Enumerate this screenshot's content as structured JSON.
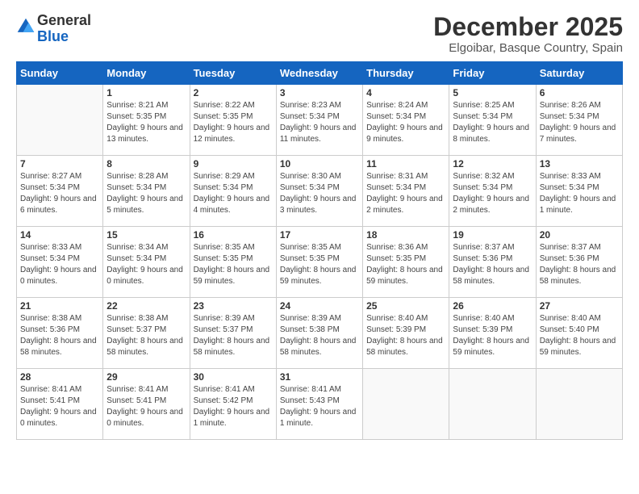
{
  "header": {
    "logo_general": "General",
    "logo_blue": "Blue",
    "month_year": "December 2025",
    "location": "Elgoibar, Basque Country, Spain"
  },
  "weekdays": [
    "Sunday",
    "Monday",
    "Tuesday",
    "Wednesday",
    "Thursday",
    "Friday",
    "Saturday"
  ],
  "weeks": [
    [
      {
        "day": "",
        "sunrise": "",
        "sunset": "",
        "daylight": ""
      },
      {
        "day": "1",
        "sunrise": "Sunrise: 8:21 AM",
        "sunset": "Sunset: 5:35 PM",
        "daylight": "Daylight: 9 hours and 13 minutes."
      },
      {
        "day": "2",
        "sunrise": "Sunrise: 8:22 AM",
        "sunset": "Sunset: 5:35 PM",
        "daylight": "Daylight: 9 hours and 12 minutes."
      },
      {
        "day": "3",
        "sunrise": "Sunrise: 8:23 AM",
        "sunset": "Sunset: 5:34 PM",
        "daylight": "Daylight: 9 hours and 11 minutes."
      },
      {
        "day": "4",
        "sunrise": "Sunrise: 8:24 AM",
        "sunset": "Sunset: 5:34 PM",
        "daylight": "Daylight: 9 hours and 9 minutes."
      },
      {
        "day": "5",
        "sunrise": "Sunrise: 8:25 AM",
        "sunset": "Sunset: 5:34 PM",
        "daylight": "Daylight: 9 hours and 8 minutes."
      },
      {
        "day": "6",
        "sunrise": "Sunrise: 8:26 AM",
        "sunset": "Sunset: 5:34 PM",
        "daylight": "Daylight: 9 hours and 7 minutes."
      }
    ],
    [
      {
        "day": "7",
        "sunrise": "Sunrise: 8:27 AM",
        "sunset": "Sunset: 5:34 PM",
        "daylight": "Daylight: 9 hours and 6 minutes."
      },
      {
        "day": "8",
        "sunrise": "Sunrise: 8:28 AM",
        "sunset": "Sunset: 5:34 PM",
        "daylight": "Daylight: 9 hours and 5 minutes."
      },
      {
        "day": "9",
        "sunrise": "Sunrise: 8:29 AM",
        "sunset": "Sunset: 5:34 PM",
        "daylight": "Daylight: 9 hours and 4 minutes."
      },
      {
        "day": "10",
        "sunrise": "Sunrise: 8:30 AM",
        "sunset": "Sunset: 5:34 PM",
        "daylight": "Daylight: 9 hours and 3 minutes."
      },
      {
        "day": "11",
        "sunrise": "Sunrise: 8:31 AM",
        "sunset": "Sunset: 5:34 PM",
        "daylight": "Daylight: 9 hours and 2 minutes."
      },
      {
        "day": "12",
        "sunrise": "Sunrise: 8:32 AM",
        "sunset": "Sunset: 5:34 PM",
        "daylight": "Daylight: 9 hours and 2 minutes."
      },
      {
        "day": "13",
        "sunrise": "Sunrise: 8:33 AM",
        "sunset": "Sunset: 5:34 PM",
        "daylight": "Daylight: 9 hours and 1 minute."
      }
    ],
    [
      {
        "day": "14",
        "sunrise": "Sunrise: 8:33 AM",
        "sunset": "Sunset: 5:34 PM",
        "daylight": "Daylight: 9 hours and 0 minutes."
      },
      {
        "day": "15",
        "sunrise": "Sunrise: 8:34 AM",
        "sunset": "Sunset: 5:34 PM",
        "daylight": "Daylight: 9 hours and 0 minutes."
      },
      {
        "day": "16",
        "sunrise": "Sunrise: 8:35 AM",
        "sunset": "Sunset: 5:35 PM",
        "daylight": "Daylight: 8 hours and 59 minutes."
      },
      {
        "day": "17",
        "sunrise": "Sunrise: 8:35 AM",
        "sunset": "Sunset: 5:35 PM",
        "daylight": "Daylight: 8 hours and 59 minutes."
      },
      {
        "day": "18",
        "sunrise": "Sunrise: 8:36 AM",
        "sunset": "Sunset: 5:35 PM",
        "daylight": "Daylight: 8 hours and 59 minutes."
      },
      {
        "day": "19",
        "sunrise": "Sunrise: 8:37 AM",
        "sunset": "Sunset: 5:36 PM",
        "daylight": "Daylight: 8 hours and 58 minutes."
      },
      {
        "day": "20",
        "sunrise": "Sunrise: 8:37 AM",
        "sunset": "Sunset: 5:36 PM",
        "daylight": "Daylight: 8 hours and 58 minutes."
      }
    ],
    [
      {
        "day": "21",
        "sunrise": "Sunrise: 8:38 AM",
        "sunset": "Sunset: 5:36 PM",
        "daylight": "Daylight: 8 hours and 58 minutes."
      },
      {
        "day": "22",
        "sunrise": "Sunrise: 8:38 AM",
        "sunset": "Sunset: 5:37 PM",
        "daylight": "Daylight: 8 hours and 58 minutes."
      },
      {
        "day": "23",
        "sunrise": "Sunrise: 8:39 AM",
        "sunset": "Sunset: 5:37 PM",
        "daylight": "Daylight: 8 hours and 58 minutes."
      },
      {
        "day": "24",
        "sunrise": "Sunrise: 8:39 AM",
        "sunset": "Sunset: 5:38 PM",
        "daylight": "Daylight: 8 hours and 58 minutes."
      },
      {
        "day": "25",
        "sunrise": "Sunrise: 8:40 AM",
        "sunset": "Sunset: 5:39 PM",
        "daylight": "Daylight: 8 hours and 58 minutes."
      },
      {
        "day": "26",
        "sunrise": "Sunrise: 8:40 AM",
        "sunset": "Sunset: 5:39 PM",
        "daylight": "Daylight: 8 hours and 59 minutes."
      },
      {
        "day": "27",
        "sunrise": "Sunrise: 8:40 AM",
        "sunset": "Sunset: 5:40 PM",
        "daylight": "Daylight: 8 hours and 59 minutes."
      }
    ],
    [
      {
        "day": "28",
        "sunrise": "Sunrise: 8:41 AM",
        "sunset": "Sunset: 5:41 PM",
        "daylight": "Daylight: 9 hours and 0 minutes."
      },
      {
        "day": "29",
        "sunrise": "Sunrise: 8:41 AM",
        "sunset": "Sunset: 5:41 PM",
        "daylight": "Daylight: 9 hours and 0 minutes."
      },
      {
        "day": "30",
        "sunrise": "Sunrise: 8:41 AM",
        "sunset": "Sunset: 5:42 PM",
        "daylight": "Daylight: 9 hours and 1 minute."
      },
      {
        "day": "31",
        "sunrise": "Sunrise: 8:41 AM",
        "sunset": "Sunset: 5:43 PM",
        "daylight": "Daylight: 9 hours and 1 minute."
      },
      {
        "day": "",
        "sunrise": "",
        "sunset": "",
        "daylight": ""
      },
      {
        "day": "",
        "sunrise": "",
        "sunset": "",
        "daylight": ""
      },
      {
        "day": "",
        "sunrise": "",
        "sunset": "",
        "daylight": ""
      }
    ]
  ]
}
